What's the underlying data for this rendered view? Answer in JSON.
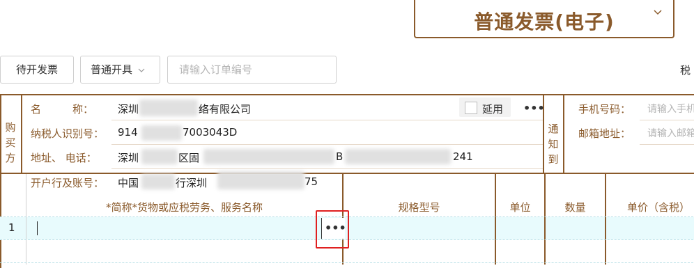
{
  "invoice_type": {
    "title": "普通发票(电子)",
    "chevron_icon": "chevron-down-icon"
  },
  "toolbar": {
    "pending_label": "待开发票",
    "mode_label": "普通开具",
    "order_placeholder": "请输入订单编号",
    "right_label": "税"
  },
  "buyer": {
    "section_label": [
      "购",
      "买",
      "方"
    ],
    "name_label": "名　　　称：",
    "name_value_a": "深圳",
    "name_value_b": "络有限公司",
    "extend_label": "延用",
    "more": "•••",
    "tax_label": "纳税人识别号：",
    "tax_value_a": "914",
    "tax_value_b": "7003043D",
    "addr_label": "地址、 电话：",
    "addr_value_a": "深圳",
    "addr_value_b": "区固",
    "addr_value_c": "B",
    "addr_value_d": "241",
    "bank_label": "开户行及账号：",
    "bank_value_a": "中国",
    "bank_value_b": "行深圳",
    "bank_value_c": "75"
  },
  "notify": {
    "section_label": [
      "通",
      "知",
      "到"
    ],
    "phone_label": "手机号码：",
    "phone_placeholder": "请输入手机",
    "email_label": "邮箱地址：",
    "email_placeholder": "请输入邮箱"
  },
  "items": {
    "headers": {
      "name": "*简称*货物或应税劳务、服务名称",
      "spec": "规格型号",
      "unit": "单位",
      "qty": "数量",
      "price": "单价（含税）"
    },
    "rows": [
      {
        "index": "1",
        "more": "•••"
      }
    ]
  },
  "colors": {
    "brand": "#8a5a2b",
    "highlight": "#e02020",
    "row_bg": "#e8fbfd"
  }
}
